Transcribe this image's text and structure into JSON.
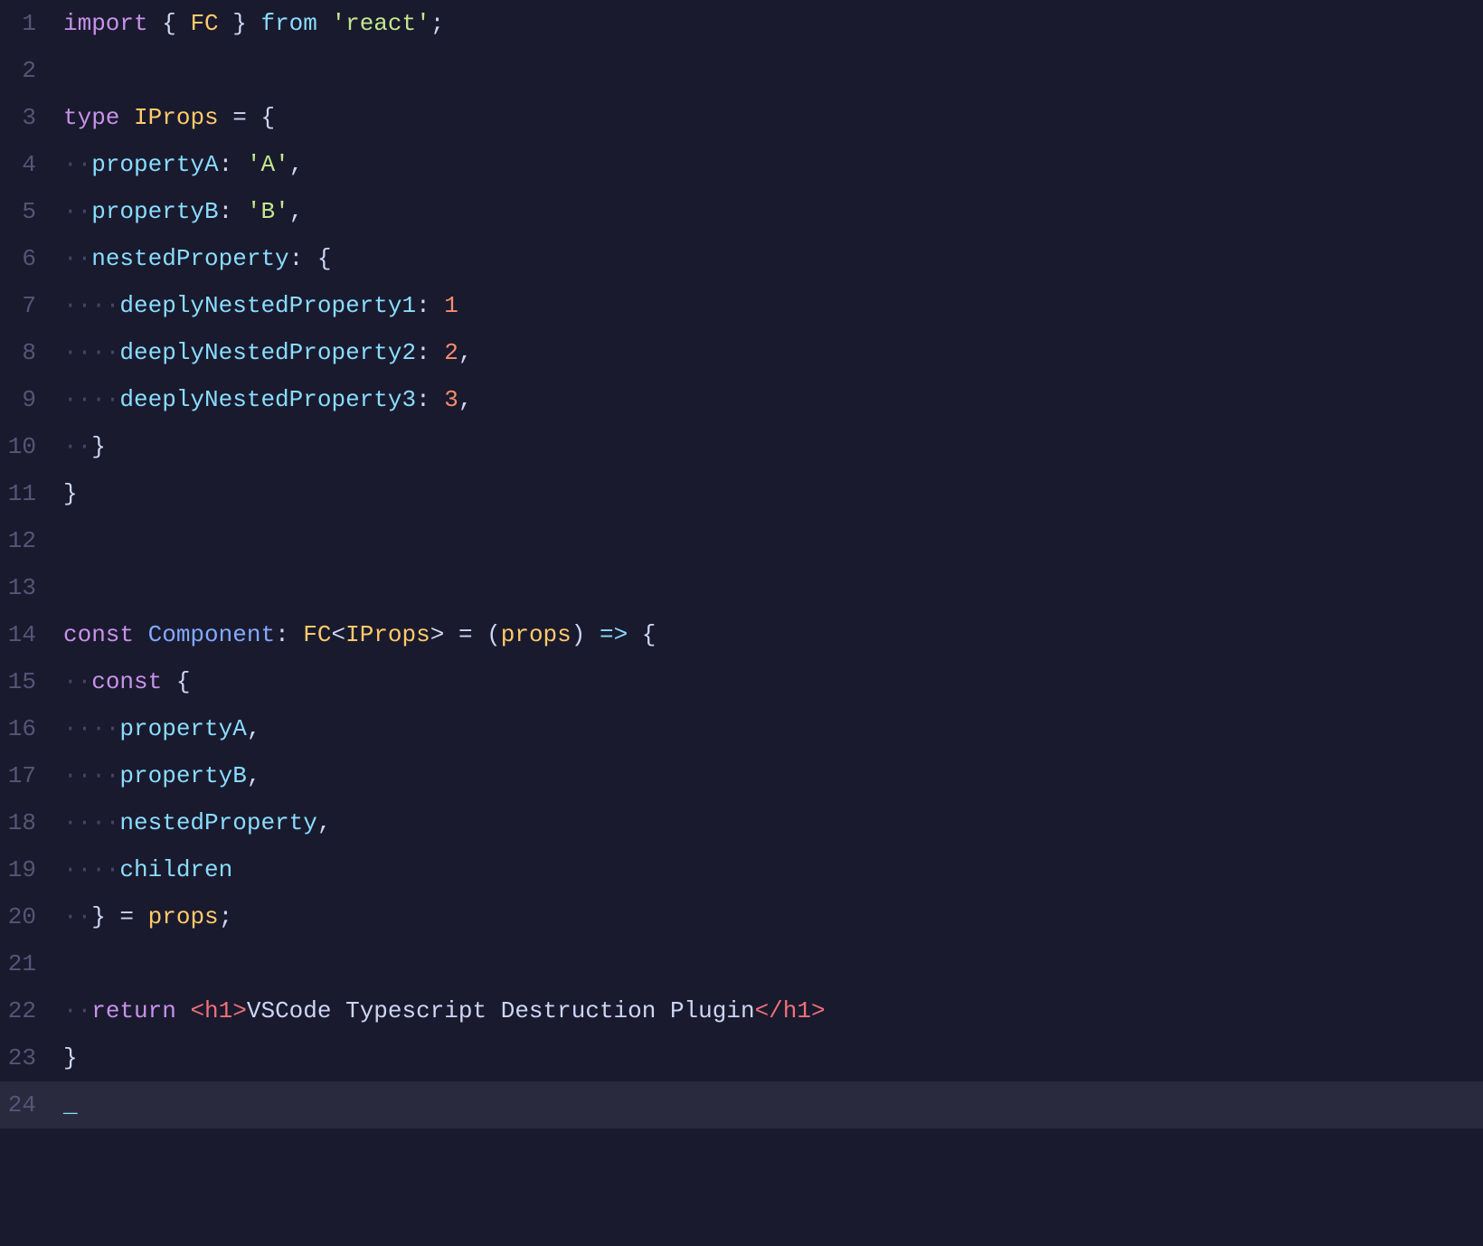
{
  "editor": {
    "background": "#1a1a2e",
    "lines": [
      {
        "num": 1,
        "tokens": [
          {
            "type": "kw-import",
            "text": "import"
          },
          {
            "type": "punct",
            "text": " { "
          },
          {
            "type": "type-name",
            "text": "FC"
          },
          {
            "type": "punct",
            "text": " } "
          },
          {
            "type": "kw-from",
            "text": "from"
          },
          {
            "type": "punct",
            "text": " "
          },
          {
            "type": "string",
            "text": "'react'"
          },
          {
            "type": "punct",
            "text": ";"
          }
        ]
      },
      {
        "num": 2,
        "tokens": []
      },
      {
        "num": 3,
        "tokens": [
          {
            "type": "kw-type",
            "text": "type"
          },
          {
            "type": "plain",
            "text": " "
          },
          {
            "type": "type-name",
            "text": "IProps"
          },
          {
            "type": "plain",
            "text": " "
          },
          {
            "type": "punct",
            "text": "= {"
          }
        ]
      },
      {
        "num": 4,
        "tokens": [
          {
            "type": "dot-indent",
            "text": "··"
          },
          {
            "type": "prop-name",
            "text": "propertyA"
          },
          {
            "type": "punct",
            "text": ": "
          },
          {
            "type": "string",
            "text": "'A'"
          },
          {
            "type": "punct",
            "text": ","
          }
        ]
      },
      {
        "num": 5,
        "tokens": [
          {
            "type": "dot-indent",
            "text": "··"
          },
          {
            "type": "prop-name",
            "text": "propertyB"
          },
          {
            "type": "punct",
            "text": ": "
          },
          {
            "type": "string",
            "text": "'B'"
          },
          {
            "type": "punct",
            "text": ","
          }
        ]
      },
      {
        "num": 6,
        "tokens": [
          {
            "type": "dot-indent",
            "text": "··"
          },
          {
            "type": "prop-name",
            "text": "nestedProperty"
          },
          {
            "type": "punct",
            "text": ": {"
          }
        ]
      },
      {
        "num": 7,
        "tokens": [
          {
            "type": "dot-indent",
            "text": "····"
          },
          {
            "type": "prop-name",
            "text": "deeplyNestedProperty1"
          },
          {
            "type": "punct",
            "text": ": "
          },
          {
            "type": "number",
            "text": "1"
          }
        ]
      },
      {
        "num": 8,
        "tokens": [
          {
            "type": "dot-indent",
            "text": "····"
          },
          {
            "type": "prop-name",
            "text": "deeplyNestedProperty2"
          },
          {
            "type": "punct",
            "text": ": "
          },
          {
            "type": "number",
            "text": "2"
          },
          {
            "type": "punct",
            "text": ","
          }
        ]
      },
      {
        "num": 9,
        "tokens": [
          {
            "type": "dot-indent",
            "text": "····"
          },
          {
            "type": "prop-name",
            "text": "deeplyNestedProperty3"
          },
          {
            "type": "punct",
            "text": ": "
          },
          {
            "type": "number",
            "text": "3"
          },
          {
            "type": "punct",
            "text": ","
          }
        ]
      },
      {
        "num": 10,
        "tokens": [
          {
            "type": "dot-indent",
            "text": "··"
          },
          {
            "type": "punct",
            "text": "}"
          }
        ]
      },
      {
        "num": 11,
        "tokens": [
          {
            "type": "punct",
            "text": "}"
          }
        ]
      },
      {
        "num": 12,
        "tokens": []
      },
      {
        "num": 13,
        "tokens": []
      },
      {
        "num": 14,
        "tokens": [
          {
            "type": "kw-const",
            "text": "const"
          },
          {
            "type": "plain",
            "text": " "
          },
          {
            "type": "identifier",
            "text": "Component"
          },
          {
            "type": "punct",
            "text": ": "
          },
          {
            "type": "type-name",
            "text": "FC"
          },
          {
            "type": "punct",
            "text": "<"
          },
          {
            "type": "type-name",
            "text": "IProps"
          },
          {
            "type": "punct",
            "text": "> = ("
          },
          {
            "type": "props-param",
            "text": "props"
          },
          {
            "type": "punct",
            "text": ") "
          },
          {
            "type": "arrow",
            "text": "=>"
          },
          {
            "type": "punct",
            "text": " {"
          }
        ]
      },
      {
        "num": 15,
        "tokens": [
          {
            "type": "dot-indent",
            "text": "··"
          },
          {
            "type": "kw-const",
            "text": "const"
          },
          {
            "type": "punct",
            "text": " {"
          }
        ]
      },
      {
        "num": 16,
        "tokens": [
          {
            "type": "dot-indent",
            "text": "····"
          },
          {
            "type": "prop-name",
            "text": "propertyA"
          },
          {
            "type": "punct",
            "text": ","
          }
        ]
      },
      {
        "num": 17,
        "tokens": [
          {
            "type": "dot-indent",
            "text": "····"
          },
          {
            "type": "prop-name",
            "text": "propertyB"
          },
          {
            "type": "punct",
            "text": ","
          }
        ]
      },
      {
        "num": 18,
        "tokens": [
          {
            "type": "dot-indent",
            "text": "····"
          },
          {
            "type": "prop-name",
            "text": "nestedProperty"
          },
          {
            "type": "punct",
            "text": ","
          }
        ]
      },
      {
        "num": 19,
        "tokens": [
          {
            "type": "dot-indent",
            "text": "····"
          },
          {
            "type": "prop-name",
            "text": "children"
          }
        ]
      },
      {
        "num": 20,
        "tokens": [
          {
            "type": "dot-indent",
            "text": "··"
          },
          {
            "type": "punct",
            "text": "} = "
          },
          {
            "type": "props-param",
            "text": "props"
          },
          {
            "type": "punct",
            "text": ";"
          }
        ]
      },
      {
        "num": 21,
        "tokens": []
      },
      {
        "num": 22,
        "tokens": [
          {
            "type": "dot-indent",
            "text": "··"
          },
          {
            "type": "kw-return",
            "text": "return"
          },
          {
            "type": "plain",
            "text": " "
          },
          {
            "type": "html-tag",
            "text": "<h1>"
          },
          {
            "type": "html-text",
            "text": "VSCode Typescript Destruction Plugin"
          },
          {
            "type": "html-tag",
            "text": "</h1>"
          }
        ]
      },
      {
        "num": 23,
        "tokens": [
          {
            "type": "punct",
            "text": "}"
          }
        ]
      },
      {
        "num": 24,
        "tokens": [
          {
            "type": "cursor",
            "text": "_"
          }
        ],
        "isCursorLine": true
      }
    ]
  }
}
